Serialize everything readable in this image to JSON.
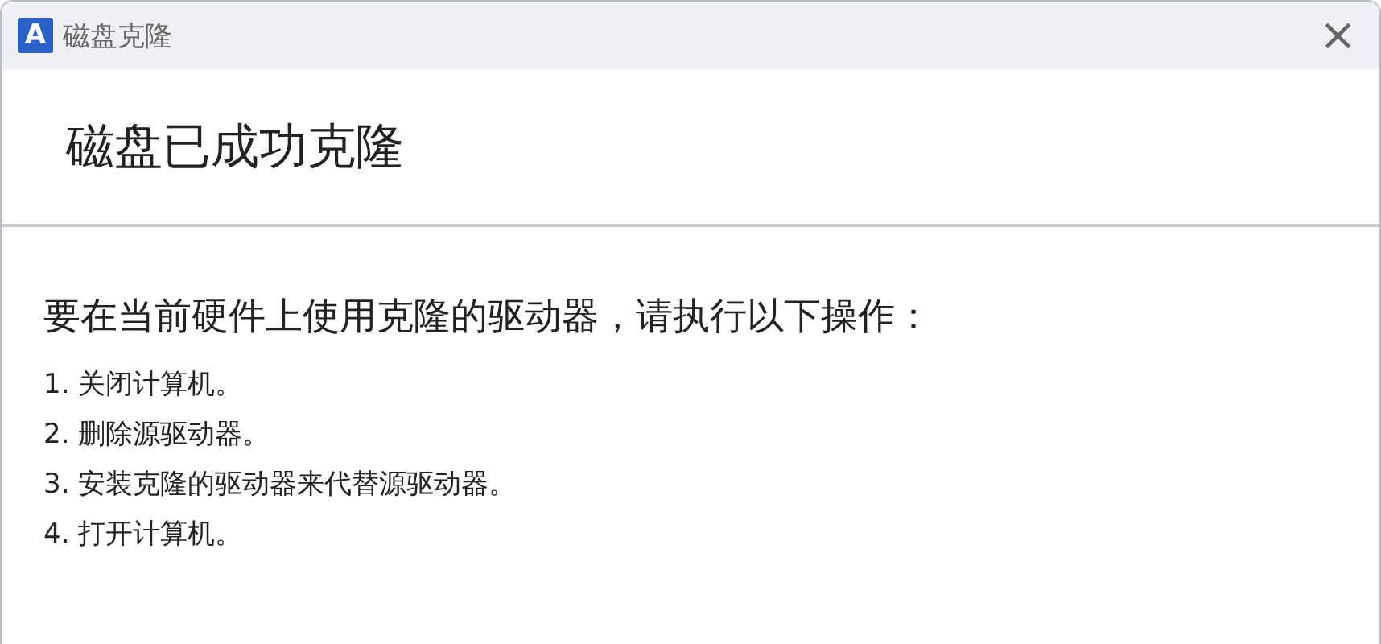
{
  "window": {
    "logo_letter": "A",
    "title": "磁盘克隆",
    "close": "×"
  },
  "heading": "磁盘已成功克隆",
  "instruction": "要在当前硬件上使用克隆的驱动器，请执行以下操作：",
  "steps": [
    "1. 关闭计算机。",
    "2. 删除源驱动器。",
    "3. 安装克隆的驱动器来代替源驱动器。",
    "4. 打开计算机。"
  ]
}
